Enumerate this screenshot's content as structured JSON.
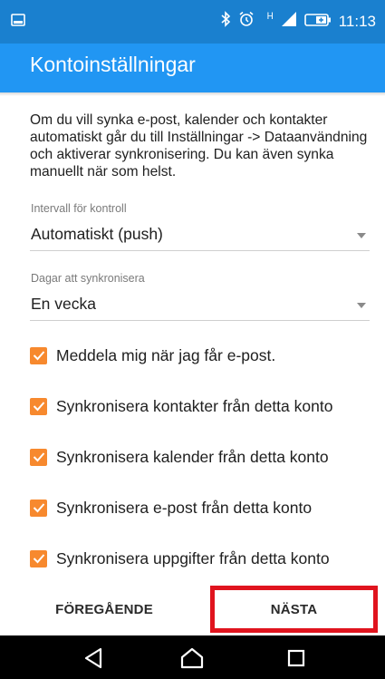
{
  "status_bar": {
    "time": "11:13",
    "network_label": "H",
    "icons": [
      "gallery-icon",
      "bluetooth-icon",
      "alarm-icon",
      "signal-icon",
      "battery-icon"
    ]
  },
  "app_bar": {
    "title": "Kontoinställningar"
  },
  "info_text": "Om du vill synka e-post, kalender och kontakter automatiskt går du till Inställningar -> Dataanvändning och aktiverar synkronisering. Du kan även synka manuellt när som helst.",
  "check_interval": {
    "label": "Intervall för kontroll",
    "value": "Automatiskt (push)"
  },
  "sync_days": {
    "label": "Dagar att synkronisera",
    "value": "En vecka"
  },
  "checkboxes": [
    {
      "label": "Meddela mig när jag får e-post.",
      "checked": true
    },
    {
      "label": "Synkronisera kontakter från detta konto",
      "checked": true
    },
    {
      "label": "Synkronisera kalender från detta konto",
      "checked": true
    },
    {
      "label": "Synkronisera e-post från detta konto",
      "checked": true
    },
    {
      "label": "Synkronisera uppgifter från detta konto",
      "checked": true
    }
  ],
  "buttons": {
    "previous": "FÖREGÅENDE",
    "next": "NÄSTA"
  },
  "colors": {
    "status_bar": "#1a80cf",
    "app_bar": "#2196f3",
    "checkbox": "#f7892e",
    "highlight": "#e0141e"
  }
}
